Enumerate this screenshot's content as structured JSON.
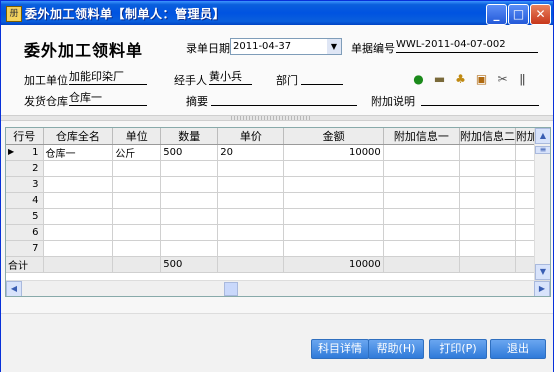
{
  "window": {
    "title": "委外加工领料单【制单人：管理员】",
    "app_icon": "册",
    "buttons": {
      "minimize": "_",
      "maximize": "□",
      "close": "✕"
    }
  },
  "header": {
    "form_title": "委外加工领料单",
    "entry_date_label": "录单日期",
    "entry_date_value": "2011-04-37",
    "doc_no_label": "单据编号",
    "doc_no_value": "WWL-2011-04-07-002",
    "processor_label": "加工单位",
    "processor_value": "加能印染厂",
    "handler_label": "经手人",
    "handler_value": "黄小兵",
    "dept_label": "部门",
    "dept_value": "",
    "warehouse_label": "发货仓库",
    "warehouse_value": "仓库一",
    "summary_label": "摘要",
    "summary_value": "",
    "extra_label": "附加说明",
    "extra_value": ""
  },
  "toolbar_icons": [
    {
      "name": "status-light-icon",
      "glyph": "●",
      "color": "#1b8a1b"
    },
    {
      "name": "scanner-icon",
      "glyph": "▬",
      "color": "#7a6a3a"
    },
    {
      "name": "lock-icon",
      "glyph": "♣",
      "color": "#c08a12"
    },
    {
      "name": "book-icon",
      "glyph": "▣",
      "color": "#b06a10"
    },
    {
      "name": "tools-icon",
      "glyph": "✂",
      "color": "#555555"
    },
    {
      "name": "brush-icon",
      "glyph": "ǁ",
      "color": "#555555"
    }
  ],
  "grid": {
    "columns": [
      "行号",
      "仓库全名",
      "单位",
      "数量",
      "单价",
      "金额",
      "附加信息一",
      "附加信息二",
      "附加信"
    ],
    "rows": [
      {
        "no": "1",
        "warehouse": "仓库一",
        "unit": "公斤",
        "qty": "500",
        "price": "20",
        "amount": "10000",
        "extra1": "",
        "extra2": "",
        "extra3": ""
      },
      {
        "no": "2",
        "warehouse": "",
        "unit": "",
        "qty": "",
        "price": "",
        "amount": "",
        "extra1": "",
        "extra2": "",
        "extra3": ""
      },
      {
        "no": "3",
        "warehouse": "",
        "unit": "",
        "qty": "",
        "price": "",
        "amount": "",
        "extra1": "",
        "extra2": "",
        "extra3": ""
      },
      {
        "no": "4",
        "warehouse": "",
        "unit": "",
        "qty": "",
        "price": "",
        "amount": "",
        "extra1": "",
        "extra2": "",
        "extra3": ""
      },
      {
        "no": "5",
        "warehouse": "",
        "unit": "",
        "qty": "",
        "price": "",
        "amount": "",
        "extra1": "",
        "extra2": "",
        "extra3": ""
      },
      {
        "no": "6",
        "warehouse": "",
        "unit": "",
        "qty": "",
        "price": "",
        "amount": "",
        "extra1": "",
        "extra2": "",
        "extra3": ""
      },
      {
        "no": "7",
        "warehouse": "",
        "unit": "",
        "qty": "",
        "price": "",
        "amount": "",
        "extra1": "",
        "extra2": "",
        "extra3": ""
      }
    ],
    "total": {
      "label": "合计",
      "qty": "500",
      "amount": "10000"
    },
    "current_row_marker": "▶"
  },
  "footer": {
    "detail_button": "科目详情",
    "help_button": "帮助(H)",
    "print_button": "打印(P)",
    "exit_button": "退出"
  },
  "colors": {
    "title_bar": "#0a5fdc",
    "footer_button": "#2f7ad9"
  }
}
